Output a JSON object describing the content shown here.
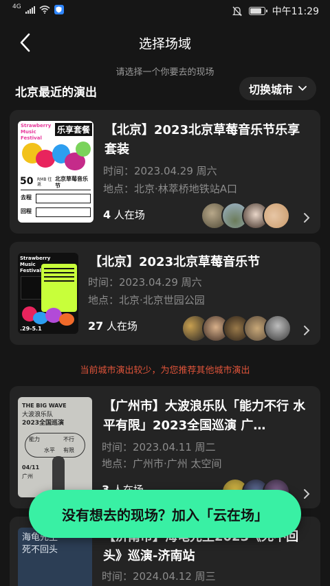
{
  "status_bar": {
    "network": "4G",
    "time": "中午11:29",
    "battery_level": 0.75,
    "icons": [
      "signal-icon",
      "wifi-icon",
      "shield-icon",
      "mute-icon",
      "battery-icon"
    ]
  },
  "header": {
    "title": "选择场域",
    "subtitle": "请选择一个你要去的现场"
  },
  "section": {
    "title": "北京最近的演出",
    "city_switch": "切换城市"
  },
  "events_local": [
    {
      "title": "【北京】2023北京草莓音乐节乐享套装",
      "time": "时间：2023.04.29  周六",
      "place": "地点：北京·林萃桥地铁站A口",
      "count": "4",
      "count_suffix": "人在场",
      "poster": {
        "brand": "Strawberry Music Festival",
        "headline": "乐享套餐",
        "price": "50",
        "price_unit": "RMB 往返",
        "subtitle": "北京草莓音乐节",
        "route_go": "去程",
        "route_back": "回程"
      }
    },
    {
      "title": "【北京】2023北京草莓音乐节",
      "time": "时间：2023.04.29  周六",
      "place": "地点：北京·北京世园公园",
      "count": "27",
      "count_suffix": "人在场",
      "poster": {
        "brand": "Strawberry Music Festival",
        "dates": ".29-5.1"
      }
    }
  ],
  "notice": "当前城市演出较少，为您推荐其他城市演出",
  "events_other": [
    {
      "title": "【广州市】大波浪乐队「能力不行 水平有限」2023全国巡演 广…",
      "time": "时间：2023.04.11  周二",
      "place": "地点：广州市·广州 太空间",
      "count": "3",
      "count_suffix": "人在场",
      "poster": {
        "title_en": "THE BIG WAVE",
        "title_cn": "大波浪乐队",
        "tour": "2023全国巡演",
        "tag1": "能力",
        "tag2": "不行",
        "tag3": "水平",
        "tag4": "有限",
        "date": "04/11",
        "city": "广州"
      }
    },
    {
      "title": "【济南市】海龟先生2023《死不回头》巡演-济南站",
      "time": "时间：2024.04.12  周三",
      "poster": {
        "text": "海龟先生 死不回头"
      }
    }
  ],
  "join_button": "没有想去的现场？加入「云在场」",
  "colors": {
    "accent": "#39f0a4",
    "notice": "#e0543a",
    "card": "#242424",
    "background": "#161616"
  }
}
